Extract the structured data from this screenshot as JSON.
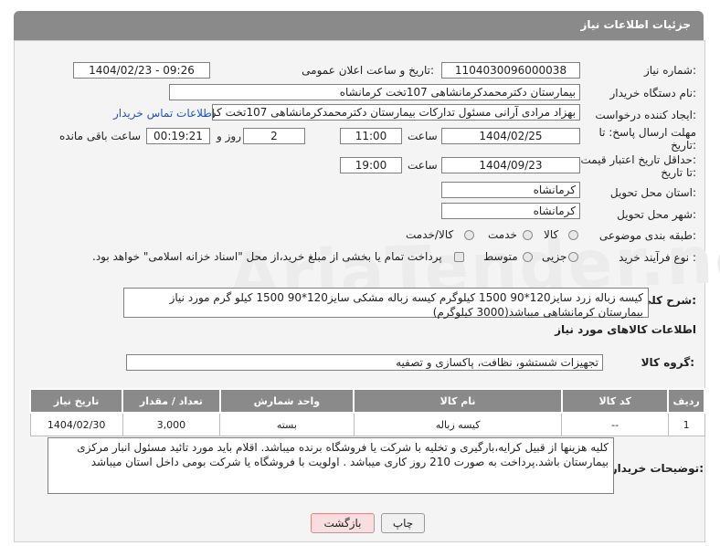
{
  "header": {
    "title": "جزئیات اطلاعات نیاز"
  },
  "watermark": "AriaTender.neT",
  "fields": {
    "need_number_label": "شماره نیاز:",
    "need_number": "1104030096000038",
    "announce_label": "تاریخ و ساعت اعلان عمومی:",
    "announce_value": "1404/02/23 - 09:26",
    "buyer_org_label": "نام دستگاه خریدار:",
    "buyer_org": "بیمارستان دکترمحمدکرمانشاهی 107تخت کرمانشاه",
    "creator_label": "ایجاد کننده درخواست:",
    "creator": "بهزاد مرادی آرانی مسئول تدارکات بیمارستان دکترمحمدکرمانشاهی 107تخت کر",
    "contact_link": "اطلاعات تماس خریدار",
    "deadline_label_1": "مهلت ارسال پاسخ: تا",
    "deadline_label_2": "تاریخ:",
    "deadline_date": "1404/02/25",
    "time_label": "ساعت",
    "deadline_time": "11:00",
    "days_value": "2",
    "days_label": "روز و",
    "remaining_value": "00:19:21",
    "remaining_label": "ساعت باقی مانده",
    "validity_label_1": "حداقل تاریخ اعتبار قیمت:",
    "validity_label_2": "تا تاریخ:",
    "validity_date": "1404/09/23",
    "validity_time": "19:00",
    "province_label": "استان محل تحویل:",
    "province": "کرمانشاه",
    "city_label": "شهر محل تحویل:",
    "city": "کرمانشاه",
    "category_label": "طبقه بندی موضوعی:",
    "category_options": [
      "کالا",
      "خدمت",
      "کالا/خدمت"
    ],
    "process_label": "نوع فرآیند خرید :",
    "process_options": [
      "جزیی",
      "متوسط"
    ],
    "payment_note": "پرداخت تمام یا بخشی از مبلغ خرید،از محل \"اسناد خزانه اسلامی\" خواهد بود.",
    "description_label": "شرح کلی نیاز:",
    "description": "کیسه زباله زرد سایز120*90 1500 کیلوگرم کیسه زباله مشکی سایز120*90 1500 کیلو گرم  مورد نیاز بیمارستان کرمانشاهی میباشد(3000 کیلوگرم)"
  },
  "goods_section": {
    "title": "اطلاعات کالاهای مورد نیاز",
    "group_label": "گروه کالا:",
    "group_value": "تجهیزات شستشو، نظافت، پاکسازی و تصفیه"
  },
  "table": {
    "headers": [
      "ردیف",
      "کد کالا",
      "نام کالا",
      "واحد شمارش",
      "تعداد / مقدار",
      "تاریخ نیاز"
    ],
    "rows": [
      [
        "1",
        "--",
        "کیسه زباله",
        "بسته",
        "3,000",
        "1404/02/30"
      ]
    ]
  },
  "buyer_notes": {
    "label": "توضیحات خریدار:",
    "text": "کلیه هزینها از قبیل کرایه،بارگیری و تخلیه با شرکت یا فروشگاه برنده میباشد. اقلام باید مورد تائید مسئول انبار مرکزی بیمارستان باشد.پرداخت به صورت 210 روز کاری میباشد . اولویت با فروشگاه یا شرکت بومی داخل استان میباشد"
  },
  "buttons": {
    "print": "چاپ",
    "back": "بازگشت"
  }
}
